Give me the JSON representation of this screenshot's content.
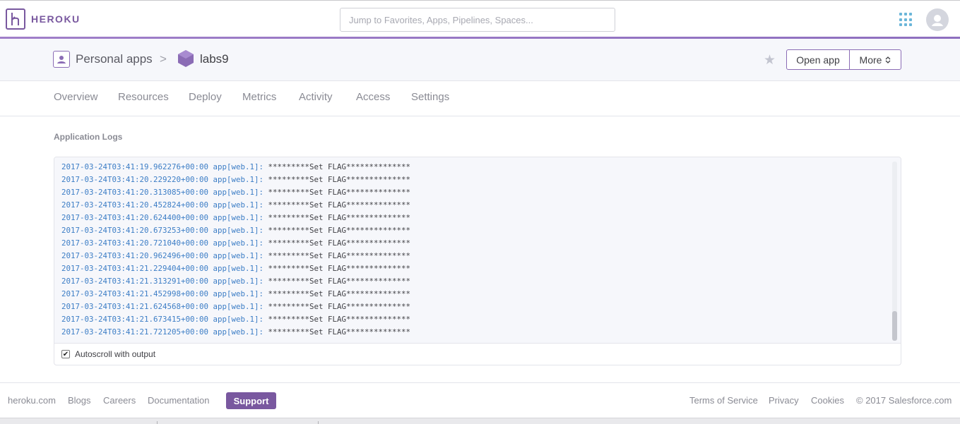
{
  "nav": {
    "brand": "HEROKU",
    "search_placeholder": "Jump to Favorites, Apps, Pipelines, Spaces...",
    "apps_icon": "apps-grid-icon",
    "avatar_icon": "user-avatar-icon"
  },
  "header": {
    "owner": "Personal apps",
    "separator": ">",
    "app_name": "labs9",
    "open_app": "Open app",
    "more": "More"
  },
  "tabs": [
    "Overview",
    "Resources",
    "Deploy",
    "Metrics",
    "Activity",
    "Access",
    "Settings"
  ],
  "logs": {
    "title": "Application Logs",
    "lines": [
      {
        "ts": "2017-03-24T03:41:19.962276+00:00 app[web.1]:",
        "msg": " *********Set FLAG**************"
      },
      {
        "ts": "2017-03-24T03:41:20.229220+00:00 app[web.1]:",
        "msg": " *********Set FLAG**************"
      },
      {
        "ts": "2017-03-24T03:41:20.313085+00:00 app[web.1]:",
        "msg": " *********Set FLAG**************"
      },
      {
        "ts": "2017-03-24T03:41:20.452824+00:00 app[web.1]:",
        "msg": " *********Set FLAG**************"
      },
      {
        "ts": "2017-03-24T03:41:20.624400+00:00 app[web.1]:",
        "msg": " *********Set FLAG**************"
      },
      {
        "ts": "2017-03-24T03:41:20.673253+00:00 app[web.1]:",
        "msg": " *********Set FLAG**************"
      },
      {
        "ts": "2017-03-24T03:41:20.721040+00:00 app[web.1]:",
        "msg": " *********Set FLAG**************"
      },
      {
        "ts": "2017-03-24T03:41:20.962496+00:00 app[web.1]:",
        "msg": " *********Set FLAG**************"
      },
      {
        "ts": "2017-03-24T03:41:21.229404+00:00 app[web.1]:",
        "msg": " *********Set FLAG**************"
      },
      {
        "ts": "2017-03-24T03:41:21.313291+00:00 app[web.1]:",
        "msg": " *********Set FLAG**************"
      },
      {
        "ts": "2017-03-24T03:41:21.452998+00:00 app[web.1]:",
        "msg": " *********Set FLAG**************"
      },
      {
        "ts": "2017-03-24T03:41:21.624568+00:00 app[web.1]:",
        "msg": " *********Set FLAG**************"
      },
      {
        "ts": "2017-03-24T03:41:21.673415+00:00 app[web.1]:",
        "msg": " *********Set FLAG**************"
      },
      {
        "ts": "2017-03-24T03:41:21.721205+00:00 app[web.1]:",
        "msg": " *********Set FLAG**************"
      }
    ],
    "autoscroll_label": "Autoscroll with output",
    "autoscroll_checked": true
  },
  "footer": {
    "links_left": [
      "heroku.com",
      "Blogs",
      "Careers",
      "Documentation"
    ],
    "support": "Support",
    "links_right": [
      "Terms of Service",
      "Privacy",
      "Cookies",
      "© 2017 Salesforce.com"
    ]
  },
  "colors": {
    "brand": "#79589f",
    "log_timestamp": "#3d7ec6",
    "accent_bar": "#a07fc9"
  }
}
